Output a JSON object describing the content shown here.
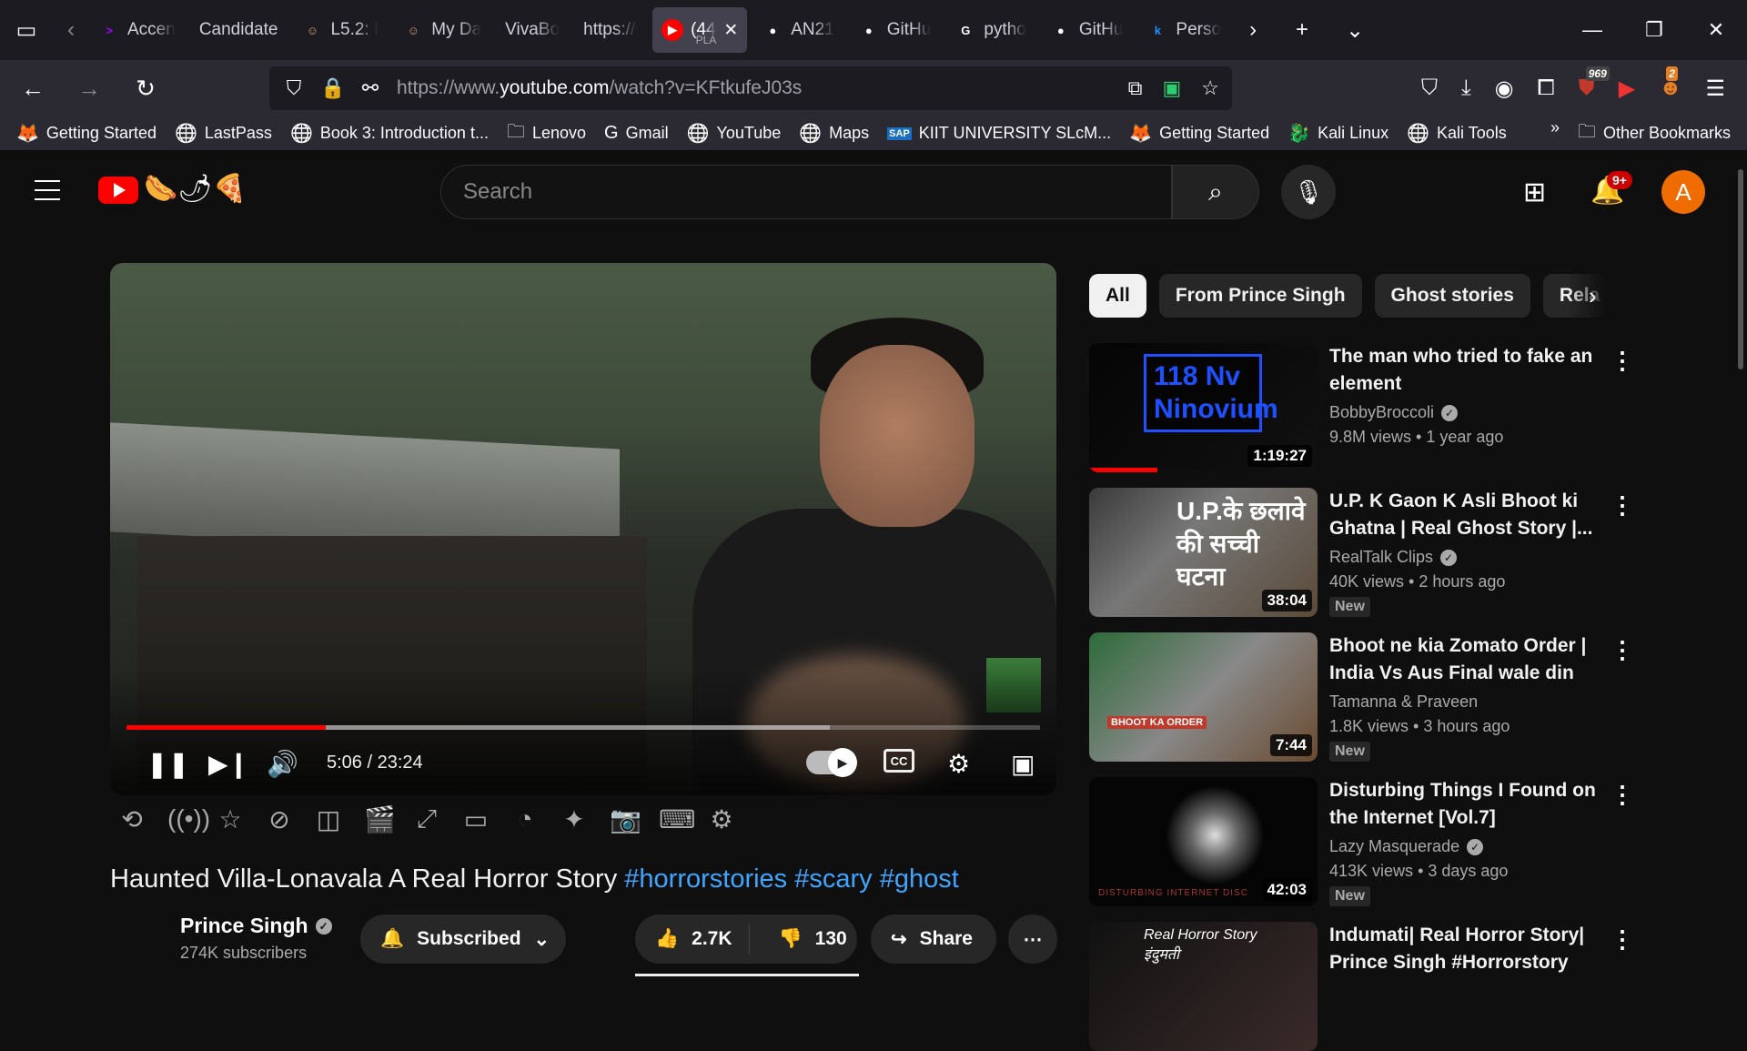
{
  "browser": {
    "tabs": [
      {
        "label": "Accen",
        "icon": "accenture-icon"
      },
      {
        "label": "Candidate",
        "icon": ""
      },
      {
        "label": "L5.2: I",
        "icon": "avatar-icon"
      },
      {
        "label": "My Da",
        "icon": "avatar-icon"
      },
      {
        "label": "VivaBooki",
        "icon": ""
      },
      {
        "label": "https://viv",
        "icon": ""
      },
      {
        "label": "(44",
        "sublabel": "PLA",
        "icon": "youtube-icon",
        "active": true
      },
      {
        "label": "AN21",
        "icon": "github-icon"
      },
      {
        "label": "GitHu",
        "icon": "github-icon"
      },
      {
        "label": "pytho",
        "icon": "google-icon"
      },
      {
        "label": "GitHu",
        "icon": "github-icon"
      },
      {
        "label": "Perso",
        "icon": "k-icon"
      }
    ],
    "url_prefix": "https://www.",
    "url_domain": "youtube.com",
    "url_path": "/watch?v=KFtkufeJ03s",
    "ublock_count": "969",
    "extension_count": "2",
    "bookmarks": [
      {
        "label": "Getting Started",
        "icon": "firefox-icon"
      },
      {
        "label": "LastPass",
        "icon": "globe-icon"
      },
      {
        "label": "Book 3: Introduction t...",
        "icon": "globe-icon"
      },
      {
        "label": "Lenovo",
        "icon": "folder-icon"
      },
      {
        "label": "Gmail",
        "icon": "google-icon"
      },
      {
        "label": "YouTube",
        "icon": "globe-icon"
      },
      {
        "label": "Maps",
        "icon": "globe-icon"
      },
      {
        "label": "KIIT UNIVERSITY SLcM...",
        "icon": "sap-icon"
      },
      {
        "label": "Getting Started",
        "icon": "firefox-icon"
      },
      {
        "label": "Kali Linux",
        "icon": "kali-icon"
      },
      {
        "label": "Kali Tools",
        "icon": "globe-icon"
      }
    ],
    "other_bookmarks": "Other Bookmarks"
  },
  "youtube": {
    "search_placeholder": "Search",
    "notifications": "9+",
    "avatar_letter": "A"
  },
  "player": {
    "time": "5:06 / 23:24",
    "progress_fraction": 0.218,
    "buffered_fraction": 0.77
  },
  "video": {
    "title": "Haunted Villa-Lonavala A Real Horror Story",
    "hashtags": [
      "#horrorstories",
      "#scary",
      "#ghost"
    ],
    "channel": "Prince Singh",
    "subscribers": "274K subscribers",
    "subscribe_label": "Subscribed",
    "likes": "2.7K",
    "dislikes": "130",
    "share_label": "Share"
  },
  "sidebar": {
    "chips": [
      "All",
      "From Prince Singh",
      "Ghost stories",
      "Rela"
    ],
    "recommendations": [
      {
        "title": "The man who tried to fake an element",
        "channel": "BobbyBroccoli",
        "verified": true,
        "views": "9.8M views",
        "age": "1 year ago",
        "duration": "1:19:27",
        "new": false,
        "watched_fraction": 0.3,
        "thumb_text": "118 Nv Ninovium"
      },
      {
        "title": "U.P. K Gaon K Asli Bhoot ki Ghatna | Real Ghost Story |...",
        "channel": "RealTalk Clips",
        "verified": true,
        "views": "40K views",
        "age": "2 hours ago",
        "duration": "38:04",
        "new": true,
        "thumb_text": "U.P.के छलावे की सच्ची घटना"
      },
      {
        "title": "Bhoot ne kia Zomato Order | India Vs Aus Final wale din kit...",
        "channel": "Tamanna & Praveen",
        "verified": false,
        "views": "1.8K views",
        "age": "3 hours ago",
        "duration": "7:44",
        "new": true,
        "thumb_text": "BHOOT KA ORDER"
      },
      {
        "title": "Disturbing Things I Found on the Internet [Vol.7]",
        "channel": "Lazy Masquerade",
        "verified": true,
        "views": "413K views",
        "age": "3 days ago",
        "duration": "42:03",
        "new": true,
        "thumb_text": "DISTURBING INTERNET DISC"
      },
      {
        "title": "Indumati| Real Horror Story| Prince Singh #Horrorstory",
        "channel": "",
        "verified": false,
        "views": "",
        "age": "",
        "duration": "",
        "new": false,
        "thumb_text": "Real Horror Story इंदुमती"
      }
    ],
    "new_label": "New"
  }
}
